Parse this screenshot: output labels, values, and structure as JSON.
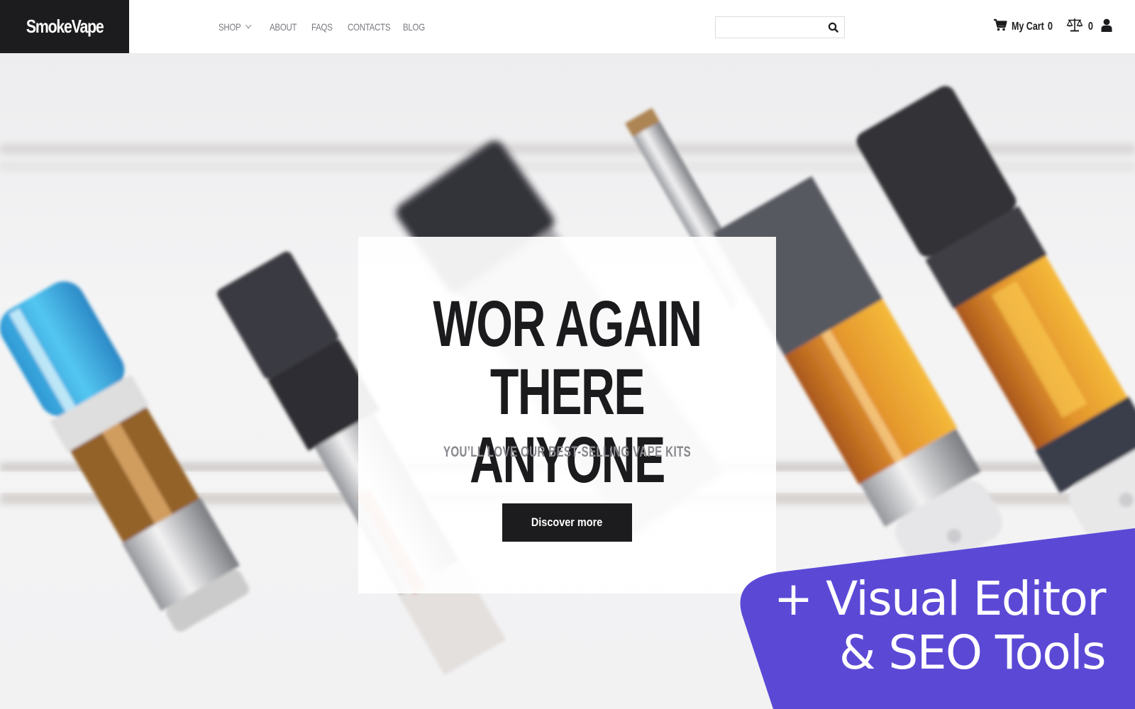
{
  "header": {
    "logo": "SmokeVape",
    "nav": [
      {
        "label": "SHOP",
        "has_dropdown": true
      },
      {
        "label": "ABOUT",
        "has_dropdown": false
      },
      {
        "label": "FAQS",
        "has_dropdown": false
      },
      {
        "label": "CONTACTS",
        "has_dropdown": false
      },
      {
        "label": "BLOG",
        "has_dropdown": false
      }
    ],
    "search": {
      "value": "",
      "placeholder": "",
      "icon": "search-icon"
    },
    "cart": {
      "icon": "cart-icon",
      "label": "My Cart",
      "count": "0"
    },
    "compare": {
      "icon": "scales-icon",
      "count": "0"
    },
    "account": {
      "icon": "user-icon"
    }
  },
  "hero": {
    "headline_line1": "WOR AGAIN",
    "headline_line2": "THERE ANYONE",
    "subheadline": "YOU’LL LOVE OUR BEST-SELLING VAPE KITS",
    "cta_label": "Discover more",
    "background": "blurred-vape-cartridges-photo"
  },
  "promo": {
    "line1": "+ Visual Editor",
    "line2": "& SEO Tools",
    "color": "#5b49d6"
  },
  "colors": {
    "brand_dark": "#1c1c1e",
    "nav_text": "#7a7a80",
    "subheadline": "#87878d",
    "promo_purple": "#5b49d6"
  }
}
